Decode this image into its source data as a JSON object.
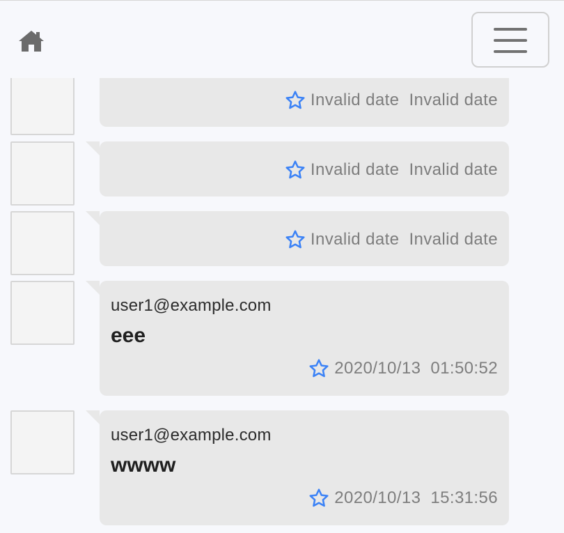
{
  "navbar": {
    "home_icon": "home-icon",
    "menu_icon": "hamburger-menu-icon"
  },
  "colors": {
    "star": "#3b82f6",
    "bubble": "#e8e8e8",
    "meta_text": "#7d7d7d"
  },
  "messages": [
    {
      "email": "",
      "body": "",
      "date": "Invalid date",
      "time": "Invalid date",
      "star_icon": "star-outline-icon"
    },
    {
      "email": "",
      "body": "",
      "date": "Invalid date",
      "time": "Invalid date",
      "star_icon": "star-outline-icon"
    },
    {
      "email": "",
      "body": "",
      "date": "Invalid date",
      "time": "Invalid date",
      "star_icon": "star-outline-icon"
    },
    {
      "email": "user1@example.com",
      "body": "eee",
      "date": "2020/10/13",
      "time": "01:50:52",
      "star_icon": "star-outline-icon"
    },
    {
      "email": "user1@example.com",
      "body": "wwww",
      "date": "2020/10/13",
      "time": "15:31:56",
      "star_icon": "star-outline-icon"
    }
  ]
}
